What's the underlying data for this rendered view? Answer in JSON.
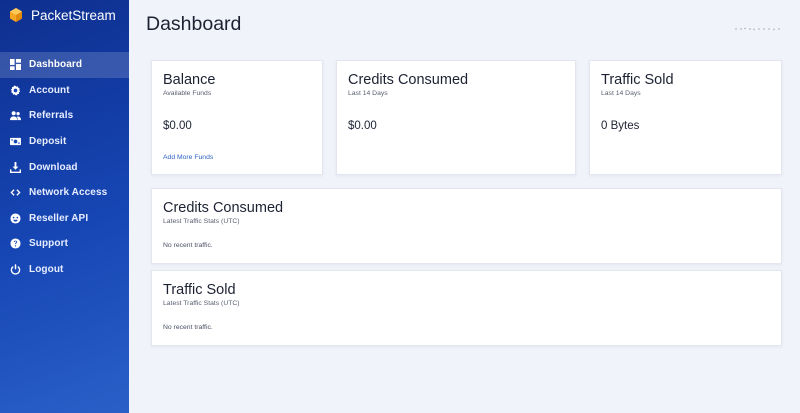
{
  "brand": {
    "name": "PacketStream"
  },
  "sidebar": {
    "items": [
      {
        "label": "Dashboard",
        "icon": "dashboard-icon",
        "active": true
      },
      {
        "label": "Account",
        "icon": "gear-icon",
        "active": false
      },
      {
        "label": "Referrals",
        "icon": "users-icon",
        "active": false
      },
      {
        "label": "Deposit",
        "icon": "money-icon",
        "active": false
      },
      {
        "label": "Download",
        "icon": "download-icon",
        "active": false
      },
      {
        "label": "Network Access",
        "icon": "code-icon",
        "active": false
      },
      {
        "label": "Reseller API",
        "icon": "api-icon",
        "active": false
      },
      {
        "label": "Support",
        "icon": "help-icon",
        "active": false
      },
      {
        "label": "Logout",
        "icon": "power-icon",
        "active": false
      }
    ]
  },
  "page": {
    "title": "Dashboard"
  },
  "cards": {
    "balance": {
      "title": "Balance",
      "subtitle": "Available Funds",
      "value": "$0.00",
      "link": "Add More Funds"
    },
    "credits": {
      "title": "Credits Consumed",
      "subtitle": "Last 14 Days",
      "value": "$0.00"
    },
    "traffic": {
      "title": "Traffic Sold",
      "subtitle": "Last 14 Days",
      "value": "0 Bytes"
    }
  },
  "panels": {
    "credits": {
      "title": "Credits Consumed",
      "subtitle": "Latest Traffic Stats (UTC)",
      "note": "No recent traffic."
    },
    "traffic": {
      "title": "Traffic Sold",
      "subtitle": "Latest Traffic Stats (UTC)",
      "note": "No recent traffic."
    }
  },
  "colors": {
    "sidebar_top": "#0e2f8f",
    "sidebar_bottom": "#2a5fc8",
    "background": "#f1f3fa",
    "link": "#2f62c4",
    "logo": "#f6a623"
  }
}
